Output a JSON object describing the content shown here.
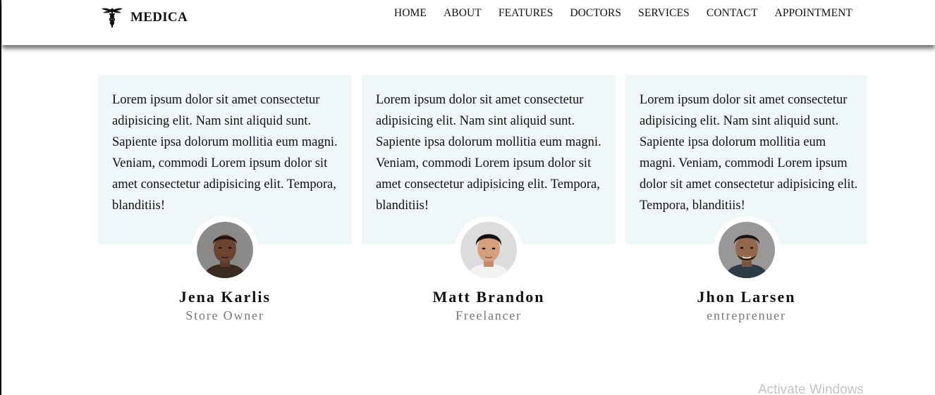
{
  "brand": {
    "name": "MEDICA",
    "icon": "caduceus-icon"
  },
  "nav": {
    "items": [
      "HOME",
      "ABOUT",
      "FEATURES",
      "DOCTORS",
      "SERVICES",
      "CONTACT",
      "APPOINTMENT"
    ]
  },
  "testimonials": [
    {
      "quote": "Lorem ipsum dolor sit amet consectetur adipisicing elit. Nam sint aliquid sunt. Sapiente ipsa dolorum mollitia eum magni. Veniam, commodi Lorem ipsum dolor sit amet consectetur adipisicing elit. Tempora, blanditiis!",
      "name": "Jena Karlis",
      "role": "Store Owner"
    },
    {
      "quote": "Lorem ipsum dolor sit amet consectetur adipisicing elit. Nam sint aliquid sunt. Sapiente ipsa dolorum mollitia eum magni. Veniam, commodi Lorem ipsum dolor sit amet consectetur adipisicing elit. Tempora, blanditiis!",
      "name": "Matt Brandon",
      "role": "Freelancer"
    },
    {
      "quote": "Lorem ipsum dolor sit amet consectetur adipisicing elit. Nam sint aliquid sunt. Sapiente ipsa dolorum mollitia eum magni. Veniam, commodi Lorem ipsum dolor sit amet consectetur adipisicing elit. Tempora, blanditiis!",
      "name": "Jhon Larsen",
      "role": "entreprenuer"
    }
  ],
  "watermark": "Activate Windows",
  "colors": {
    "card_background": "#eff7f8",
    "role_text": "#777777",
    "watermark": "#c4c4c4"
  }
}
